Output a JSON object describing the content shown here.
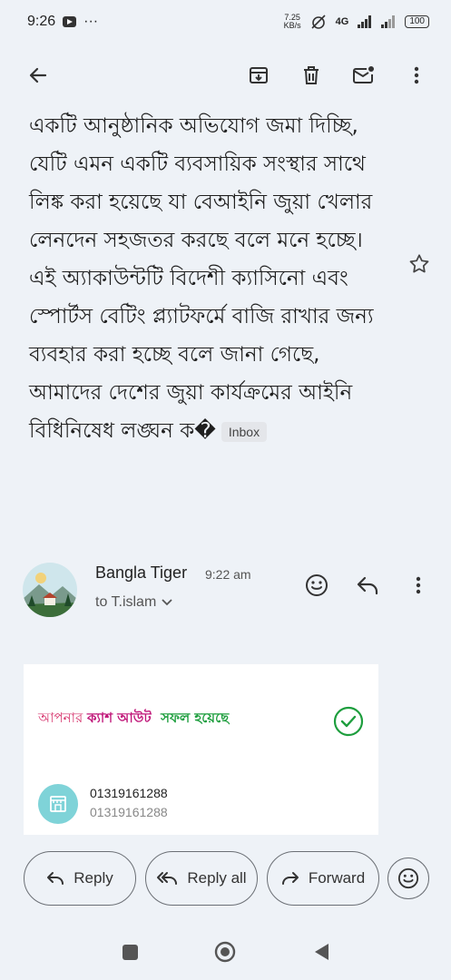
{
  "status_bar": {
    "time": "9:26",
    "dots": "···",
    "net_speed_value": "7.25",
    "net_speed_unit": "KB/s",
    "network": "4G",
    "battery": "100"
  },
  "message": {
    "body_text": "একটি আনুষ্ঠানিক অভিযোগ জমা দিচ্ছি, যেটি এমন একটি ব্যবসায়িক সংস্থার সাথে লিঙ্ক করা হয়েছে যা বেআইনি জুয়া খেলার লেনদেন সহজতর করছে বলে মনে হচ্ছে। এই অ্যাকাউন্টটি বিদেশী ক্যাসিনো এবং স্পোর্টস বেটিং প্ল্যাটফর্মে বাজি রাখার জন্য ব্যবহার করা হচ্ছে বলে জানা গেছে, আমাদের দেশের জুয়া কার্যক্রমের আইনি বিধিনিষেধ লঙ্ঘন ক�",
    "label": "Inbox"
  },
  "sender": {
    "name": "Bangla Tiger",
    "time": "9:22 am",
    "recipient": "to T.islam"
  },
  "card": {
    "seg1": "আপনার ",
    "seg2": "ক্যাশ আউট",
    "seg3": "  সফল হয়েছে",
    "account_primary": "01319161288",
    "account_secondary": "01319161288"
  },
  "actions": {
    "reply": "Reply",
    "reply_all": "Reply all",
    "forward": "Forward"
  },
  "colors": {
    "seg1": "#d6336c",
    "seg2": "#c0187a",
    "seg3": "#1e9e3e",
    "check": "#1e9e3e",
    "store_icon_bg": "#7fd3d8"
  }
}
